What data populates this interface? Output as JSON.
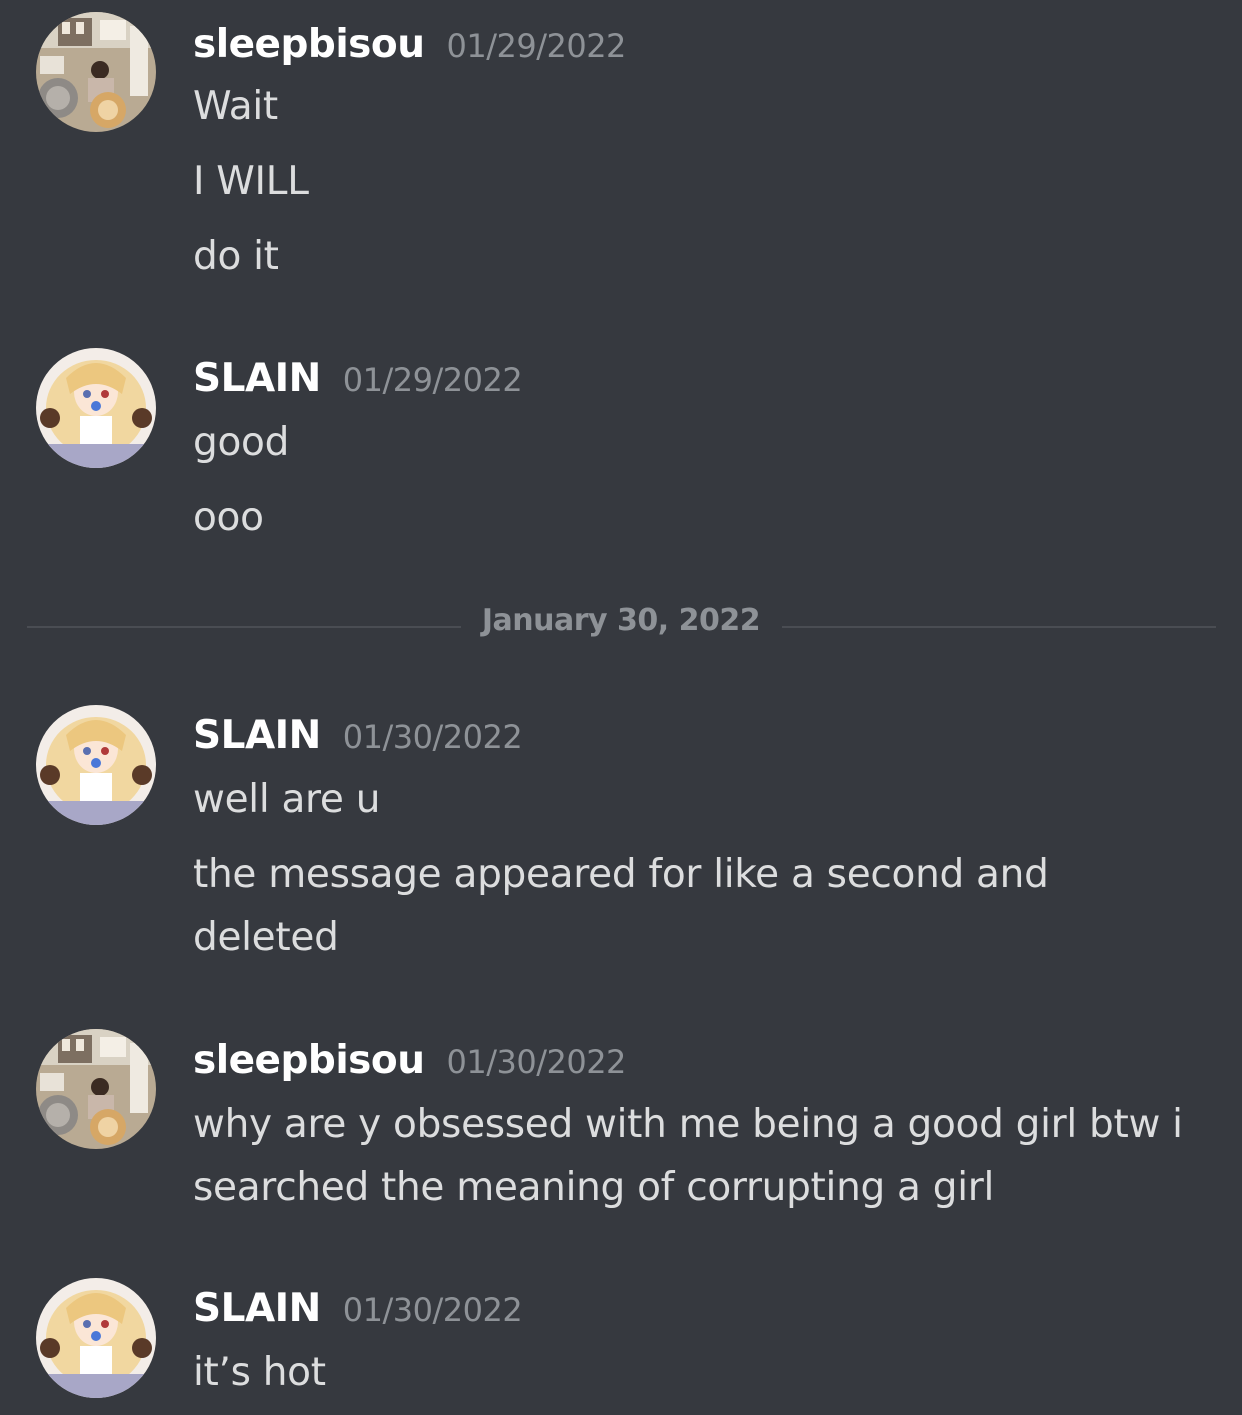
{
  "messages": [
    {
      "author": "sleepbisou",
      "timestamp": "01/29/2022",
      "avatar": "sleepbisou-avatar",
      "lines": [
        "Wait",
        "I WILL",
        "do it"
      ]
    },
    {
      "author": "SLAIN",
      "timestamp": "01/29/2022",
      "avatar": "slain-avatar",
      "lines": [
        "good",
        "ooo"
      ]
    },
    {
      "author": "SLAIN",
      "timestamp": "01/30/2022",
      "avatar": "slain-avatar",
      "lines": [
        "well are u",
        "the message appeared for like a second and deleted"
      ]
    },
    {
      "author": "sleepbisou",
      "timestamp": "01/30/2022",
      "avatar": "sleepbisou-avatar",
      "lines": [
        "why are y obsessed with me being a good girl btw i searched the meaning of corrupting a girl"
      ]
    },
    {
      "author": "SLAIN",
      "timestamp": "01/30/2022",
      "avatar": "slain-avatar",
      "lines": [
        "it’s hot"
      ]
    }
  ],
  "date_divider": "January 30, 2022",
  "colors": {
    "background": "#36393f",
    "username": "#ffffff",
    "message_text": "#dcddde",
    "timestamp": "#8e9297",
    "divider_line": "#4a4d53"
  }
}
